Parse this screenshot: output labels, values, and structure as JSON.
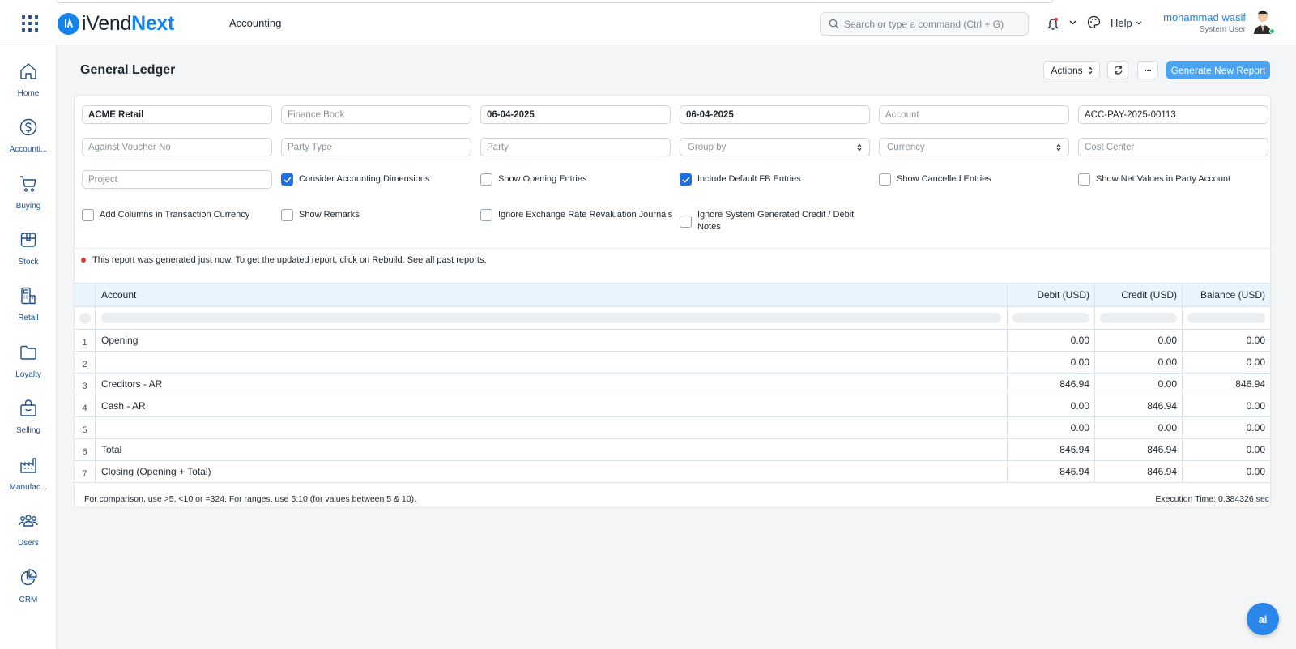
{
  "app": {
    "name_part1": "iVend",
    "name_part2": "Next",
    "module": "Accounting"
  },
  "topbar": {
    "search_placeholder": "Search or type a command (Ctrl + G)",
    "help_label": "Help",
    "user_name": "mohammad wasif",
    "user_role": "System User"
  },
  "sidebar": {
    "items": [
      {
        "label": "Home",
        "icon": "home-icon"
      },
      {
        "label": "Accounti...",
        "icon": "dollar-icon"
      },
      {
        "label": "Buying",
        "icon": "cart-icon"
      },
      {
        "label": "Stock",
        "icon": "box-icon"
      },
      {
        "label": "Retail",
        "icon": "pos-icon"
      },
      {
        "label": "Loyalty",
        "icon": "folder-icon"
      },
      {
        "label": "Selling",
        "icon": "shop-bag-icon"
      },
      {
        "label": "Manufac...",
        "icon": "factory-icon"
      },
      {
        "label": "Users",
        "icon": "users-icon"
      },
      {
        "label": "CRM",
        "icon": "pie-icon"
      }
    ]
  },
  "page": {
    "title": "General Ledger",
    "actions_label": "Actions",
    "more_label": "···",
    "generate_label": "Generate New Report"
  },
  "filters": {
    "company": "ACME Retail",
    "finance_book_placeholder": "Finance Book",
    "from_date": "06-04-2025",
    "to_date": "06-04-2025",
    "account_placeholder": "Account",
    "voucher_no": "ACC-PAY-2025-00113",
    "against_voucher_placeholder": "Against Voucher No",
    "party_type_placeholder": "Party Type",
    "party_placeholder": "Party",
    "group_by_placeholder": "Group by",
    "currency_placeholder": "Currency",
    "cost_center_placeholder": "Cost Center",
    "project_placeholder": "Project",
    "checkboxes": [
      {
        "label": "Consider Accounting Dimensions",
        "checked": true
      },
      {
        "label": "Show Opening Entries",
        "checked": false
      },
      {
        "label": "Include Default FB Entries",
        "checked": true
      },
      {
        "label": "Show Cancelled Entries",
        "checked": false
      },
      {
        "label": "Show Net Values in Party Account",
        "checked": false
      },
      {
        "label": "Add Columns in Transaction Currency",
        "checked": false
      },
      {
        "label": "Show Remarks",
        "checked": false
      },
      {
        "label": "Ignore Exchange Rate Revaluation Journals",
        "checked": false
      },
      {
        "label": "Ignore System Generated Credit / Debit Notes",
        "checked": false
      }
    ]
  },
  "notice": "This report was generated just now. To get the updated report, click on Rebuild. See all past reports.",
  "table": {
    "columns": [
      "Account",
      "Debit (USD)",
      "Credit (USD)",
      "Balance (USD)"
    ],
    "rows": [
      {
        "idx": "1",
        "account": "Opening",
        "debit": "0.00",
        "credit": "0.00",
        "balance": "0.00"
      },
      {
        "idx": "2",
        "account": "",
        "debit": "0.00",
        "credit": "0.00",
        "balance": "0.00"
      },
      {
        "idx": "3",
        "account": "Creditors - AR",
        "debit": "846.94",
        "credit": "0.00",
        "balance": "846.94"
      },
      {
        "idx": "4",
        "account": "Cash - AR",
        "debit": "0.00",
        "credit": "846.94",
        "balance": "0.00"
      },
      {
        "idx": "5",
        "account": "",
        "debit": "0.00",
        "credit": "0.00",
        "balance": "0.00"
      },
      {
        "idx": "6",
        "account": "Total",
        "debit": "846.94",
        "credit": "846.94",
        "balance": "0.00"
      },
      {
        "idx": "7",
        "account": "Closing (Opening + Total)",
        "debit": "846.94",
        "credit": "846.94",
        "balance": "0.00"
      }
    ]
  },
  "footer": {
    "hint": "For comparison, use >5, <10 or =324. For ranges, use 5:10 (for values between 5 & 10).",
    "execution": "Execution Time: 0.384326 sec"
  },
  "ai_label": "ai",
  "colors": {
    "brand": "#1683ea",
    "primary_button": "#4aa3f0",
    "checkbox_on": "#1f6fe0",
    "table_header": "#eaf4fc",
    "alert_dot": "#e03636"
  }
}
